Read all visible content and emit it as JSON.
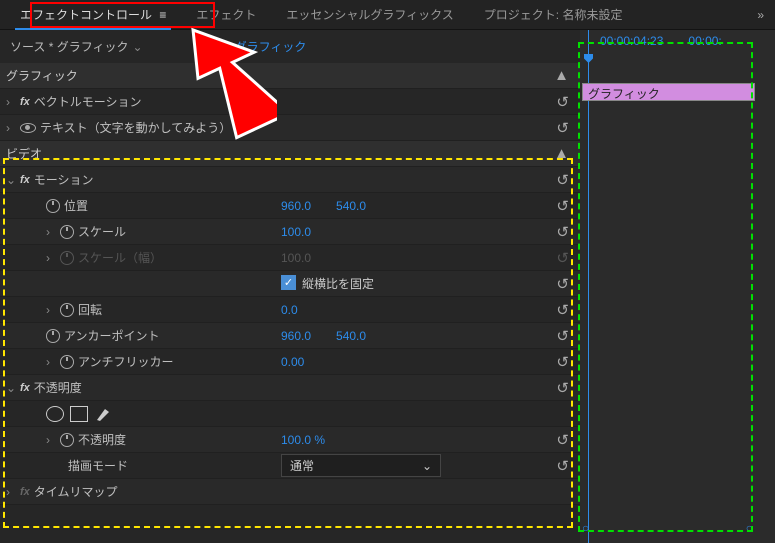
{
  "tabs": {
    "effect_controls": "エフェクトコントロール",
    "effects": "エフェクト",
    "essential_graphics": "エッセンシャルグラフィックス",
    "project": "プロジェクト: 名称未設定"
  },
  "breadcrumb": {
    "source": "ソース * グラフィック",
    "target": "* グラフィック"
  },
  "timecode": {
    "current": "00:00:04:23",
    "end": "00:00:"
  },
  "clip_name": "グラフィック",
  "section_graphic": "グラフィック",
  "vector_motion": "ベクトルモーション",
  "text_layer": "テキスト（文字を動かしてみよう）",
  "section_video": "ビデオ",
  "motion": "モーション",
  "position": {
    "label": "位置",
    "x": "960.0",
    "y": "540.0"
  },
  "scale": {
    "label": "スケール",
    "v": "100.0"
  },
  "scale_w": {
    "label": "スケール（幅）",
    "v": "100.0"
  },
  "uniform": "縦横比を固定",
  "rotation": {
    "label": "回転",
    "v": "0.0"
  },
  "anchor": {
    "label": "アンカーポイント",
    "x": "960.0",
    "y": "540.0"
  },
  "antiflicker": {
    "label": "アンチフリッカー",
    "v": "0.00"
  },
  "opacity_group": "不透明度",
  "opacity": {
    "label": "不透明度",
    "v": "100.0",
    "unit": "%"
  },
  "blend": {
    "label": "描画モード",
    "v": "通常"
  },
  "time_remap": "タイムリマップ"
}
